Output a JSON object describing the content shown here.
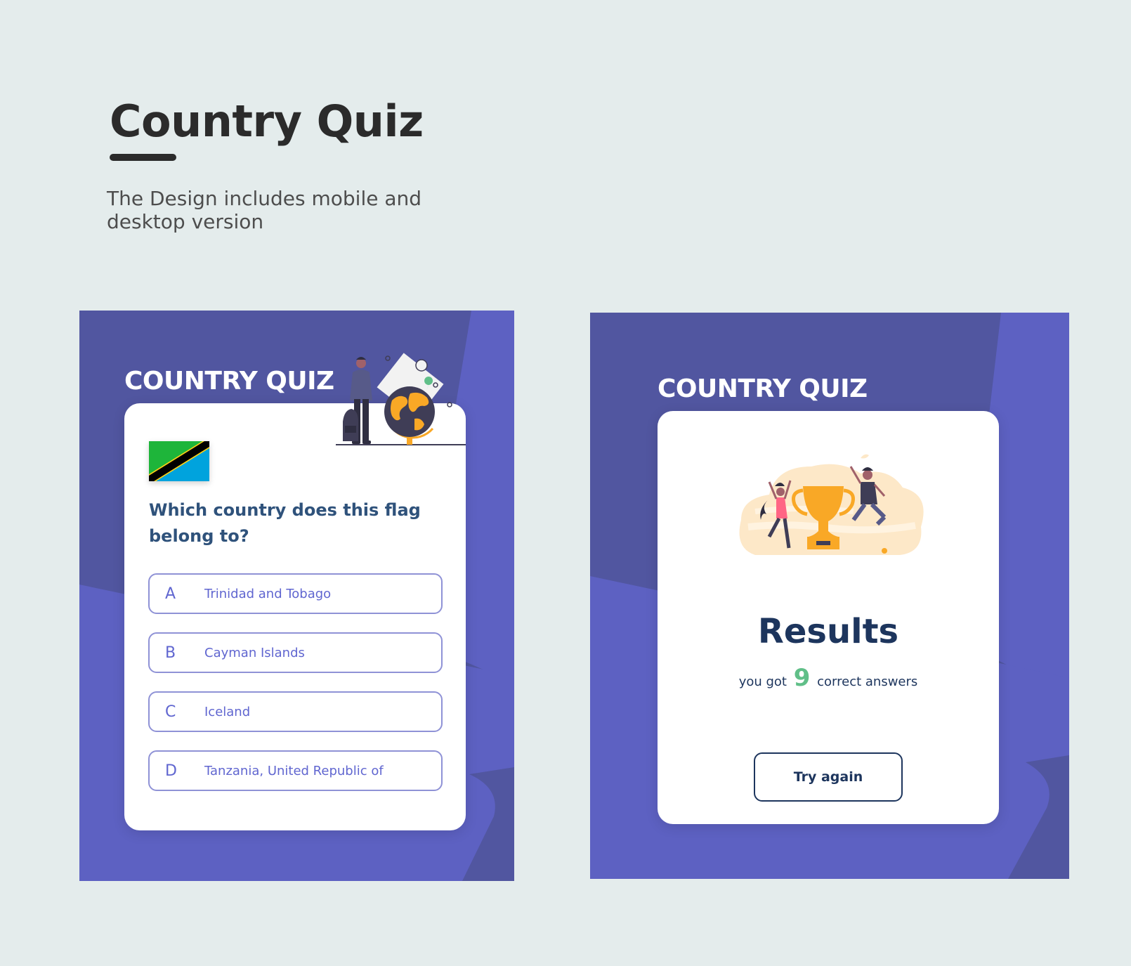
{
  "header": {
    "title": "Country Quiz",
    "subtitle": "The Design includes mobile and desktop version"
  },
  "quiz_panel": {
    "heading": "COUNTRY QUIZ",
    "flag_country": "Tanzania",
    "question": "Which country does this flag belong to?",
    "options": [
      {
        "letter": "A",
        "text": "Trinidad and Tobago"
      },
      {
        "letter": "B",
        "text": "Cayman Islands"
      },
      {
        "letter": "C",
        "text": "Iceland"
      },
      {
        "letter": "D",
        "text": "Tanzania, United Republic of"
      }
    ]
  },
  "results_panel": {
    "heading": "COUNTRY QUIZ",
    "title": "Results",
    "text_before": "you got",
    "score": "9",
    "text_after": "correct answers",
    "button_label": "Try again"
  },
  "colors": {
    "page_bg": "#e4ecec",
    "panel_dark": "#5156a0",
    "panel_light": "#5d61c2",
    "accent_text": "#2f527b",
    "option_border": "#8f92d6",
    "score_green": "#60bf88",
    "trophy": "#f9a826"
  }
}
